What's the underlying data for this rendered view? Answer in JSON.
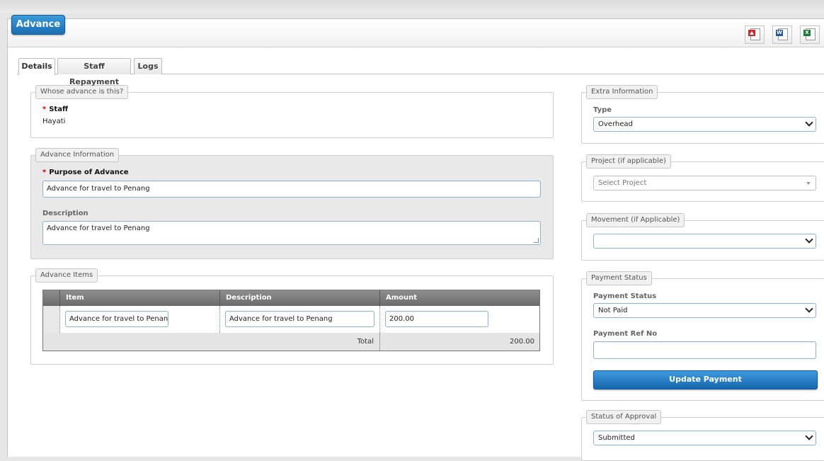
{
  "header": {
    "title": "Advance"
  },
  "export_icons": [
    {
      "name": "pdf-export-icon",
      "tag": ""
    },
    {
      "name": "word-export-icon",
      "tag": "W"
    },
    {
      "name": "excel-export-icon",
      "tag": "X"
    }
  ],
  "colors": {
    "accent": "#1a6fb3",
    "required": "#cc0000",
    "pdf": "#d22a2a",
    "word": "#2b5797",
    "excel": "#1f7a3a"
  },
  "tabs": [
    {
      "label": "Details",
      "active": true
    },
    {
      "label": "Staff Repayment",
      "active": false
    },
    {
      "label": "Logs",
      "active": false
    }
  ],
  "whose": {
    "legend": "Whose advance is this?",
    "staff_label": "Staff",
    "staff_value": "Hayati"
  },
  "advance_info": {
    "legend": "Advance Information",
    "purpose_label": "Purpose of Advance",
    "purpose_value": "Advance for travel to Penang",
    "description_label": "Description",
    "description_value": "Advance for travel to Penang"
  },
  "advance_items": {
    "legend": "Advance Items",
    "columns": [
      "Item",
      "Description",
      "Amount"
    ],
    "rows": [
      {
        "item": "Advance for travel to Penan",
        "description": "Advance for travel to Penang",
        "amount": "200.00"
      }
    ],
    "total_label": "Total",
    "total_value": "200.00"
  },
  "extra_info": {
    "legend": "Extra Information",
    "type_label": "Type",
    "type_value": "Overhead"
  },
  "project": {
    "legend": "Project (if applicable)",
    "placeholder": "Select Project"
  },
  "movement": {
    "legend": "Movement (if Applicable)",
    "value": ""
  },
  "payment": {
    "legend": "Payment Status",
    "status_label": "Payment Status",
    "status_value": "Not Paid",
    "ref_label": "Payment Ref No",
    "ref_value": "",
    "button_label": "Update Payment"
  },
  "approval": {
    "legend": "Status of Approval",
    "value": "Submitted"
  }
}
